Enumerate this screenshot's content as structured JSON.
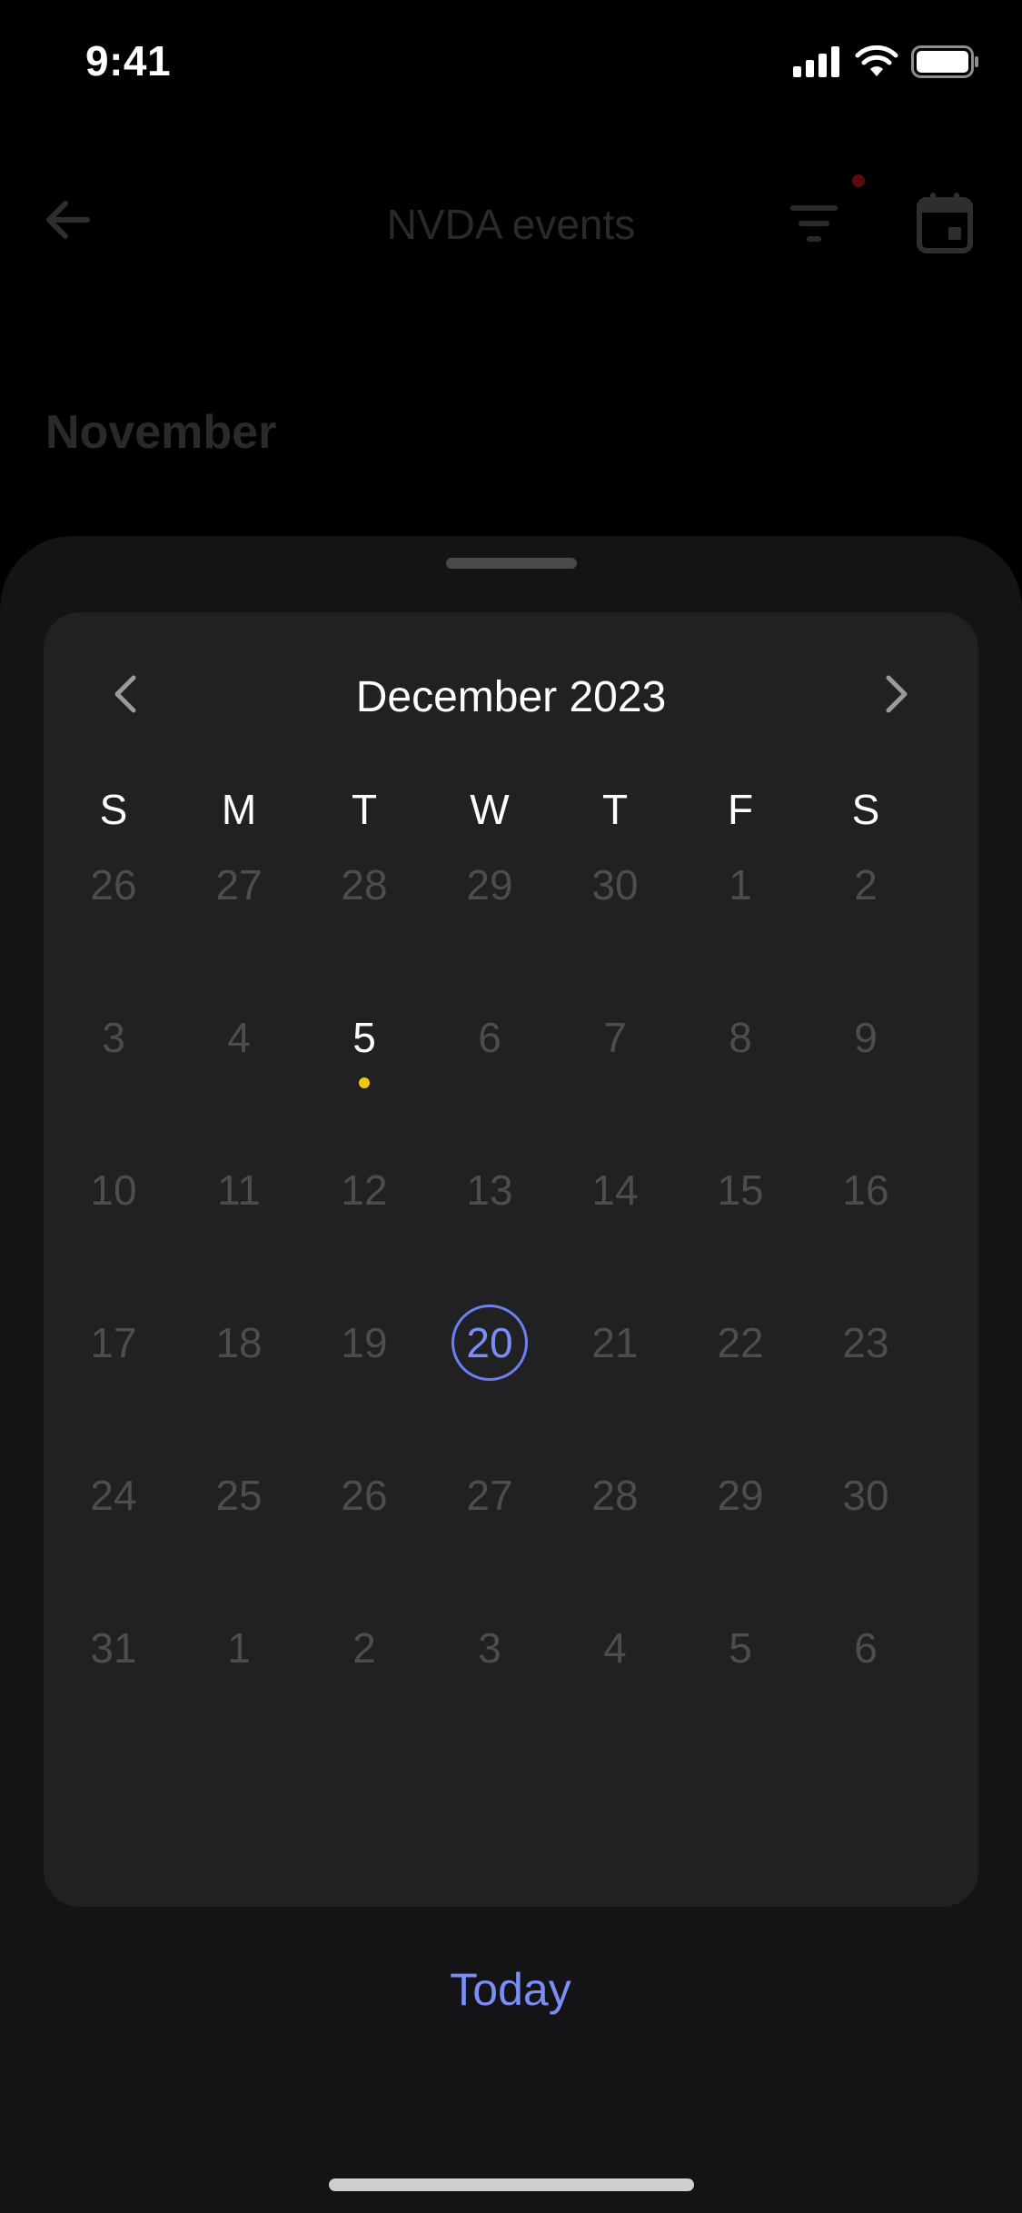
{
  "status_bar": {
    "time": "9:41"
  },
  "header": {
    "title": "NVDA events"
  },
  "background": {
    "month_heading": "November"
  },
  "calendar": {
    "month_label": "December 2023",
    "weekdays": [
      "S",
      "M",
      "T",
      "W",
      "T",
      "F",
      "S"
    ],
    "weeks": [
      [
        {
          "d": "26",
          "state": "muted"
        },
        {
          "d": "27",
          "state": "muted"
        },
        {
          "d": "28",
          "state": "muted"
        },
        {
          "d": "29",
          "state": "muted"
        },
        {
          "d": "30",
          "state": "muted"
        },
        {
          "d": "1",
          "state": "muted"
        },
        {
          "d": "2",
          "state": "muted"
        }
      ],
      [
        {
          "d": "3",
          "state": "muted"
        },
        {
          "d": "4",
          "state": "muted"
        },
        {
          "d": "5",
          "state": "active",
          "event": true
        },
        {
          "d": "6",
          "state": "muted"
        },
        {
          "d": "7",
          "state": "muted"
        },
        {
          "d": "8",
          "state": "muted"
        },
        {
          "d": "9",
          "state": "muted"
        }
      ],
      [
        {
          "d": "10",
          "state": "muted"
        },
        {
          "d": "11",
          "state": "muted"
        },
        {
          "d": "12",
          "state": "muted"
        },
        {
          "d": "13",
          "state": "muted"
        },
        {
          "d": "14",
          "state": "muted"
        },
        {
          "d": "15",
          "state": "muted"
        },
        {
          "d": "16",
          "state": "muted"
        }
      ],
      [
        {
          "d": "17",
          "state": "muted"
        },
        {
          "d": "18",
          "state": "muted"
        },
        {
          "d": "19",
          "state": "muted"
        },
        {
          "d": "20",
          "state": "today"
        },
        {
          "d": "21",
          "state": "muted"
        },
        {
          "d": "22",
          "state": "muted"
        },
        {
          "d": "23",
          "state": "muted"
        }
      ],
      [
        {
          "d": "24",
          "state": "muted"
        },
        {
          "d": "25",
          "state": "muted"
        },
        {
          "d": "26",
          "state": "muted"
        },
        {
          "d": "27",
          "state": "muted"
        },
        {
          "d": "28",
          "state": "muted"
        },
        {
          "d": "29",
          "state": "muted"
        },
        {
          "d": "30",
          "state": "muted"
        }
      ],
      [
        {
          "d": "31",
          "state": "muted"
        },
        {
          "d": "1",
          "state": "muted"
        },
        {
          "d": "2",
          "state": "muted"
        },
        {
          "d": "3",
          "state": "muted"
        },
        {
          "d": "4",
          "state": "muted"
        },
        {
          "d": "5",
          "state": "muted"
        },
        {
          "d": "6",
          "state": "muted"
        }
      ]
    ]
  },
  "actions": {
    "today_label": "Today"
  },
  "colors": {
    "accent": "#7b8df6",
    "event_dot": "#f2c80f",
    "sheet_bg": "#141416",
    "card_bg": "#212123",
    "muted_text": "#4d4d50",
    "notification_dot": "#5a0b0b"
  },
  "icons": [
    "signal-icon",
    "wifi-icon",
    "battery-icon",
    "back-arrow-icon",
    "filter-icon",
    "calendar-icon",
    "chevron-left-icon",
    "chevron-right-icon"
  ]
}
